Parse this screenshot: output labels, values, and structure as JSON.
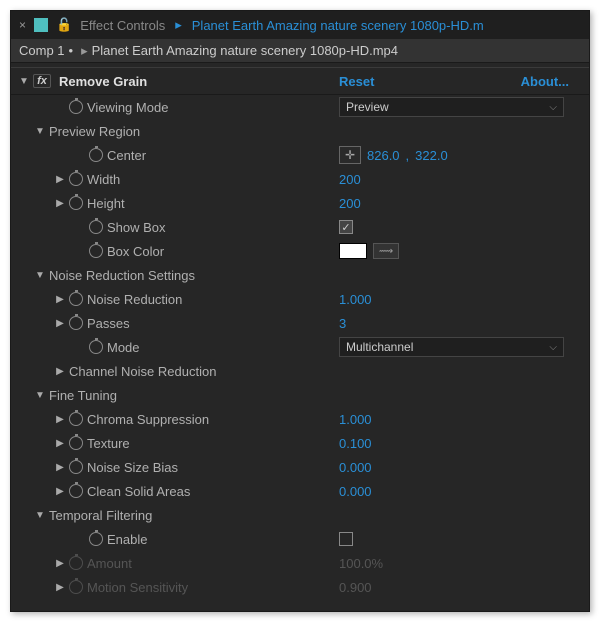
{
  "tab": {
    "title": "Effect Controls",
    "file": "Planet Earth  Amazing nature scenery 1080p-HD.m"
  },
  "breadcrumb": {
    "comp": "Comp 1",
    "layer": "Planet Earth  Amazing nature scenery 1080p-HD.mp4"
  },
  "effect": {
    "name": "Remove Grain",
    "reset": "Reset",
    "about": "About...",
    "viewingMode": {
      "label": "Viewing Mode",
      "value": "Preview"
    },
    "previewRegion": {
      "label": "Preview Region",
      "center": {
        "label": "Center",
        "x": "826.0",
        "y": "322.0"
      },
      "width": {
        "label": "Width",
        "value": "200"
      },
      "height": {
        "label": "Height",
        "value": "200"
      },
      "showBox": {
        "label": "Show Box",
        "checked": true
      },
      "boxColor": {
        "label": "Box Color",
        "value": "#FFFFFF"
      }
    },
    "noiseReduction": {
      "label": "Noise Reduction Settings",
      "nr": {
        "label": "Noise Reduction",
        "value": "1.000"
      },
      "passes": {
        "label": "Passes",
        "value": "3"
      },
      "mode": {
        "label": "Mode",
        "value": "Multichannel"
      },
      "channel": {
        "label": "Channel Noise Reduction"
      }
    },
    "fineTuning": {
      "label": "Fine Tuning",
      "chroma": {
        "label": "Chroma Suppression",
        "value": "1.000"
      },
      "texture": {
        "label": "Texture",
        "value": "0.100"
      },
      "noiseSizeBias": {
        "label": "Noise Size Bias",
        "value": "0.000"
      },
      "cleanSolid": {
        "label": "Clean Solid Areas",
        "value": "0.000"
      }
    },
    "temporal": {
      "label": "Temporal Filtering",
      "enable": {
        "label": "Enable",
        "checked": false
      },
      "amount": {
        "label": "Amount",
        "value": "100.0%"
      },
      "motion": {
        "label": "Motion Sensitivity",
        "value": "0.900"
      }
    }
  }
}
